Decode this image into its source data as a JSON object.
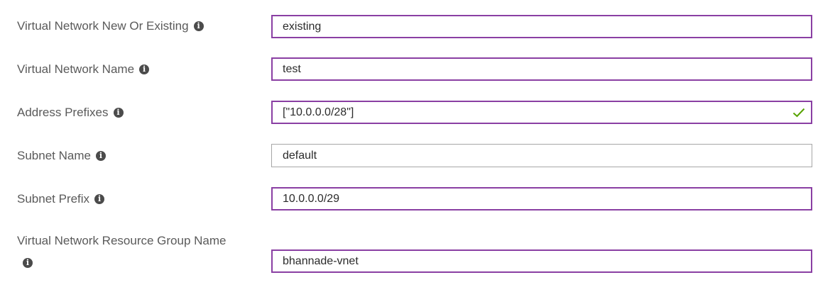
{
  "form": {
    "fields": [
      {
        "label": "Virtual Network New Or Existing",
        "value": "existing"
      },
      {
        "label": "Virtual Network Name",
        "value": "test"
      },
      {
        "label": "Address Prefixes",
        "value": "[\"10.0.0.0/28\"]"
      },
      {
        "label": "Subnet Name",
        "value": "default"
      },
      {
        "label": "Subnet Prefix",
        "value": "10.0.0.0/29"
      },
      {
        "label": "Virtual Network Resource Group Name",
        "value": "bhannade-vnet"
      }
    ],
    "info_glyph": "i"
  },
  "colors": {
    "field_border_active": "#8a3fa3",
    "field_border_default": "#a6a6a6",
    "valid_check": "#57a300"
  },
  "icons": {
    "info": "info-icon",
    "valid": "checkmark-icon"
  }
}
